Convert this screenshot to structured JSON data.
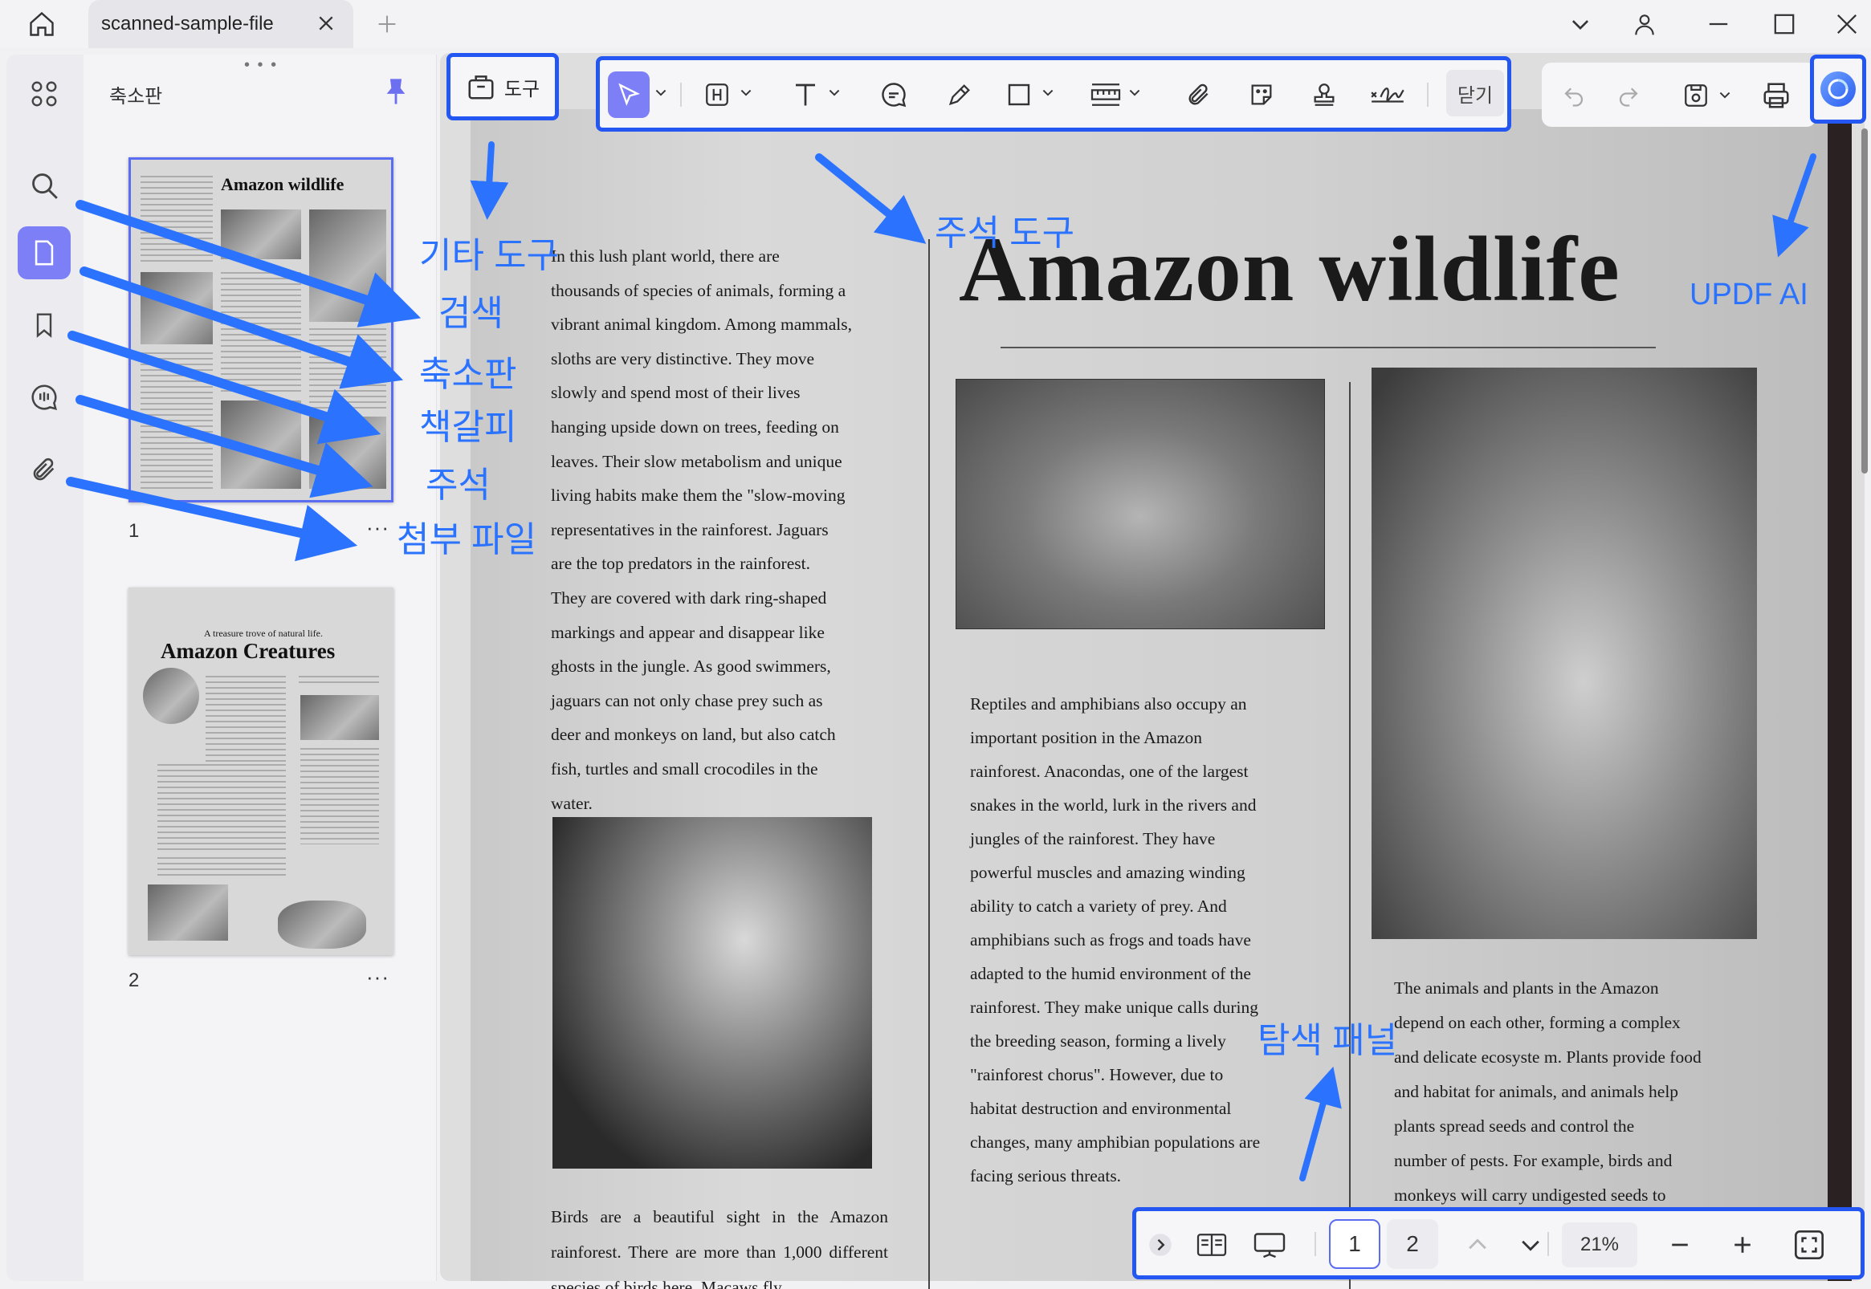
{
  "titlebar": {
    "tab_label": "scanned-sample-file"
  },
  "sidebar": {
    "panel_title": "축소판",
    "pages": [
      {
        "number": "1",
        "heading": "Amazon wildlife"
      },
      {
        "number": "2",
        "subheading": "A treasure trove of natural life.",
        "heading": "Amazon Creatures"
      }
    ]
  },
  "toolbar": {
    "other_tools_label": "도구",
    "close_label": "닫기"
  },
  "document": {
    "title": "Amazon wildlife",
    "col1_lines": [
      "In this lush plant world, there are",
      "thousands of species of animals, forming a",
      "vibrant animal kingdom. Among mammals,",
      "sloths are very distinctive. They move",
      "slowly and spend most of their lives",
      "hanging upside down on trees, feeding on",
      "leaves. Their slow metabolism and unique",
      "living habits make them the \"slow-moving",
      "representatives in the rainforest. Jaguars",
      "are the top predators in the rainforest.",
      "They are covered with dark ring-shaped",
      "markings and appear and disappear like",
      "ghosts in the jungle. As good swimmers,",
      "jaguars can not only chase prey such as",
      "deer and monkeys on land, but also catch",
      "fish, turtles and small crocodiles in the",
      "water."
    ],
    "birds_text": "Birds are a beautiful sight in the Amazon rainforest. There are more than 1,000 different species of birds here. Macaws fly",
    "col2_lines": [
      "Reptiles and amphibians also occupy an",
      "important position in the Amazon",
      "rainforest. Anacondas, one of the largest",
      "snakes in the world, lurk in the rivers and",
      "jungles of the rainforest. They have",
      "powerful muscles and amazing winding",
      "ability to catch a variety of prey. And",
      "amphibians such as frogs and toads have",
      "adapted to the humid environment of the",
      "rainforest. They make unique calls during",
      "the breeding season, forming a lively",
      "\"rainforest chorus\". However, due to",
      "habitat destruction and environmental",
      "changes, many amphibian populations are",
      "facing serious threats."
    ],
    "col3_lines": [
      "The animals and plants in the Amazon",
      "depend on each other, forming a complex",
      "and delicate ecosyste m. Plants provide food",
      "and habitat for animals, and animals help",
      "plants spread seeds and control the",
      "number of pests. For example, birds and",
      "monkeys will carry undigested seeds to"
    ]
  },
  "navigation": {
    "page_1": "1",
    "page_2": "2",
    "zoom": "21%"
  },
  "annotations": {
    "other_tools": "기타 도구",
    "search": "검색",
    "thumbnail": "축소판",
    "bookmark": "책갈피",
    "comment": "주석",
    "attachment": "첨부 파일",
    "annotation_tools": "주석 도구",
    "updf_ai": "UPDF AI",
    "navigation_panel": "탐색 패널"
  },
  "colors": {
    "accent": "#7c7ff5",
    "annotation_blue": "#2b73ff",
    "highlight_border": "#2457f2"
  },
  "icons": [
    "home-icon",
    "close-icon",
    "plus-icon",
    "chevron-down-icon",
    "user-icon",
    "minimize-icon",
    "maximize-icon",
    "window-close-icon",
    "grid-icon",
    "search-icon",
    "page-icon",
    "bookmark-icon",
    "comment-icon",
    "paperclip-icon",
    "pin-icon",
    "toolbox-icon",
    "cursor-icon",
    "heading-icon",
    "text-icon",
    "comment-bubble-icon",
    "pen-icon",
    "rectangle-icon",
    "measure-icon",
    "attach-icon",
    "sticker-icon",
    "stamp-icon",
    "signature-icon",
    "undo-icon",
    "redo-icon",
    "save-icon",
    "print-icon",
    "ai-icon",
    "expand-icon",
    "reading-mode-icon",
    "slideshow-icon",
    "up-icon",
    "down-icon",
    "minus-icon",
    "fit-icon"
  ]
}
